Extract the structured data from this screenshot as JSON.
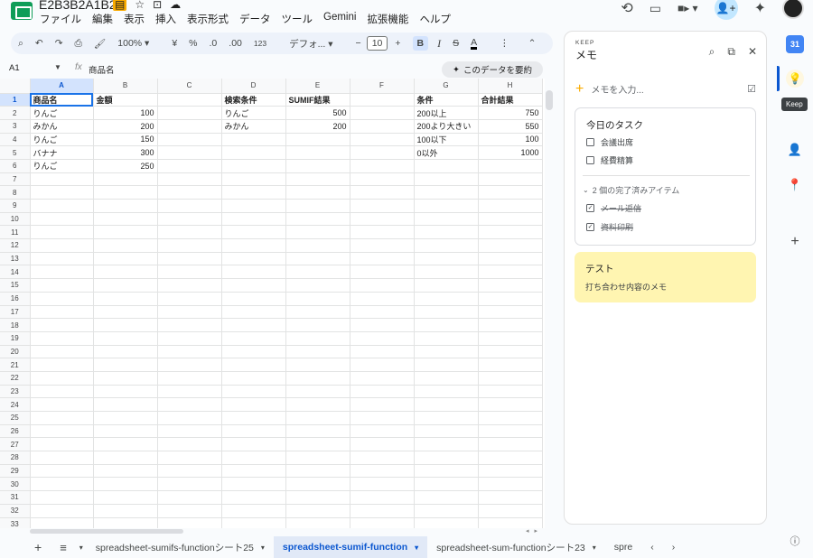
{
  "title": "E2B3B2A1B2",
  "menu": [
    "ファイル",
    "編集",
    "表示",
    "挿入",
    "表示形式",
    "データ",
    "ツール",
    "Gemini",
    "拡張機能",
    "ヘルプ"
  ],
  "toolbar": {
    "zoom": "100%",
    "currency": "¥",
    "percent": "%",
    "dec_decrease": ".0",
    "dec_increase": ".00",
    "format_more": "123",
    "font": "デフォ...",
    "font_size": "10",
    "bold": "B",
    "italic": "I",
    "strike": "S",
    "text_color": "A"
  },
  "formula_bar": {
    "cell_ref": "A1",
    "fx": "fx",
    "content": "商品名",
    "summarize_label": "このデータを要約"
  },
  "columns": [
    "A",
    "B",
    "C",
    "D",
    "E",
    "F",
    "G",
    "H"
  ],
  "rows": [
    [
      "商品名",
      "金額",
      "",
      "検索条件",
      "SUMIF結果",
      "",
      "条件",
      "合計結果"
    ],
    [
      "りんご",
      "100",
      "",
      "りんご",
      "500",
      "",
      "200以上",
      "750"
    ],
    [
      "みかん",
      "200",
      "",
      "みかん",
      "200",
      "",
      "200より大きい",
      "550"
    ],
    [
      "りんご",
      "150",
      "",
      "",
      "",
      "",
      "100以下",
      "100"
    ],
    [
      "バナナ",
      "300",
      "",
      "",
      "",
      "",
      "0以外",
      "1000"
    ],
    [
      "りんご",
      "250",
      "",
      "",
      "",
      "",
      "",
      ""
    ]
  ],
  "row_count": 33,
  "sheet_tabs": [
    {
      "label": "spreadsheet-sumifs-functionシート25",
      "active": false
    },
    {
      "label": "spreadsheet-sumif-function",
      "active": true
    },
    {
      "label": "spreadsheet-sum-functionシート23",
      "active": false
    },
    {
      "label": "spre",
      "active": false
    }
  ],
  "keep": {
    "brand": "KEEP",
    "title": "メモ",
    "input_placeholder": "メモを入力...",
    "task_note": {
      "title": "今日のタスク",
      "items": [
        {
          "label": "会議出席",
          "checked": false
        },
        {
          "label": "経費精算",
          "checked": false
        }
      ],
      "completed_label": "2 個の完了済みアイテム",
      "completed": [
        {
          "label": "メール返信",
          "checked": true
        },
        {
          "label": "資料印刷",
          "checked": true
        }
      ]
    },
    "yellow_note": {
      "title": "テスト",
      "body": "打ち合わせ内容のメモ",
      "color": "#fff5b1"
    }
  },
  "rail": {
    "calendar_day": "31",
    "tooltip": "Keep"
  },
  "colors": {
    "accent": "#0b57d0",
    "sheets_green": "#0f9d58",
    "selection": "#d3e3fd"
  }
}
